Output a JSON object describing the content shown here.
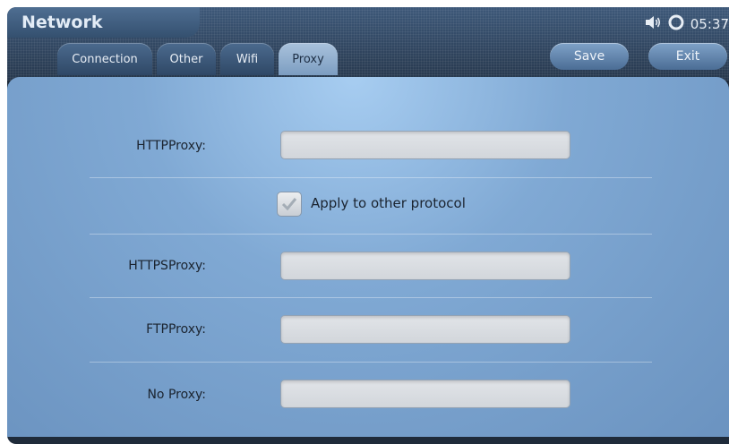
{
  "header": {
    "title": "Network",
    "volume_icon": "speaker-icon",
    "sync_icon": "refresh-ring-icon",
    "time": "05:37"
  },
  "tabs": [
    {
      "label": "Connection",
      "active": false
    },
    {
      "label": "Other",
      "active": false
    },
    {
      "label": "Wifi",
      "active": false
    },
    {
      "label": "Proxy",
      "active": true
    }
  ],
  "buttons": {
    "save": "Save",
    "exit": "Exit"
  },
  "form": {
    "http_label": "HTTPProxy:",
    "http_value": "",
    "apply_checkbox_label": "Apply to other protocol",
    "apply_checked": true,
    "https_label": "HTTPSProxy:",
    "https_value": "",
    "ftp_label": "FTPProxy:",
    "ftp_value": "",
    "noproxy_label": "No Proxy:",
    "noproxy_value": ""
  },
  "colors": {
    "panel": "#80a9d4",
    "active_tab": "#a9c2dc",
    "topbar": "#2d4059"
  }
}
